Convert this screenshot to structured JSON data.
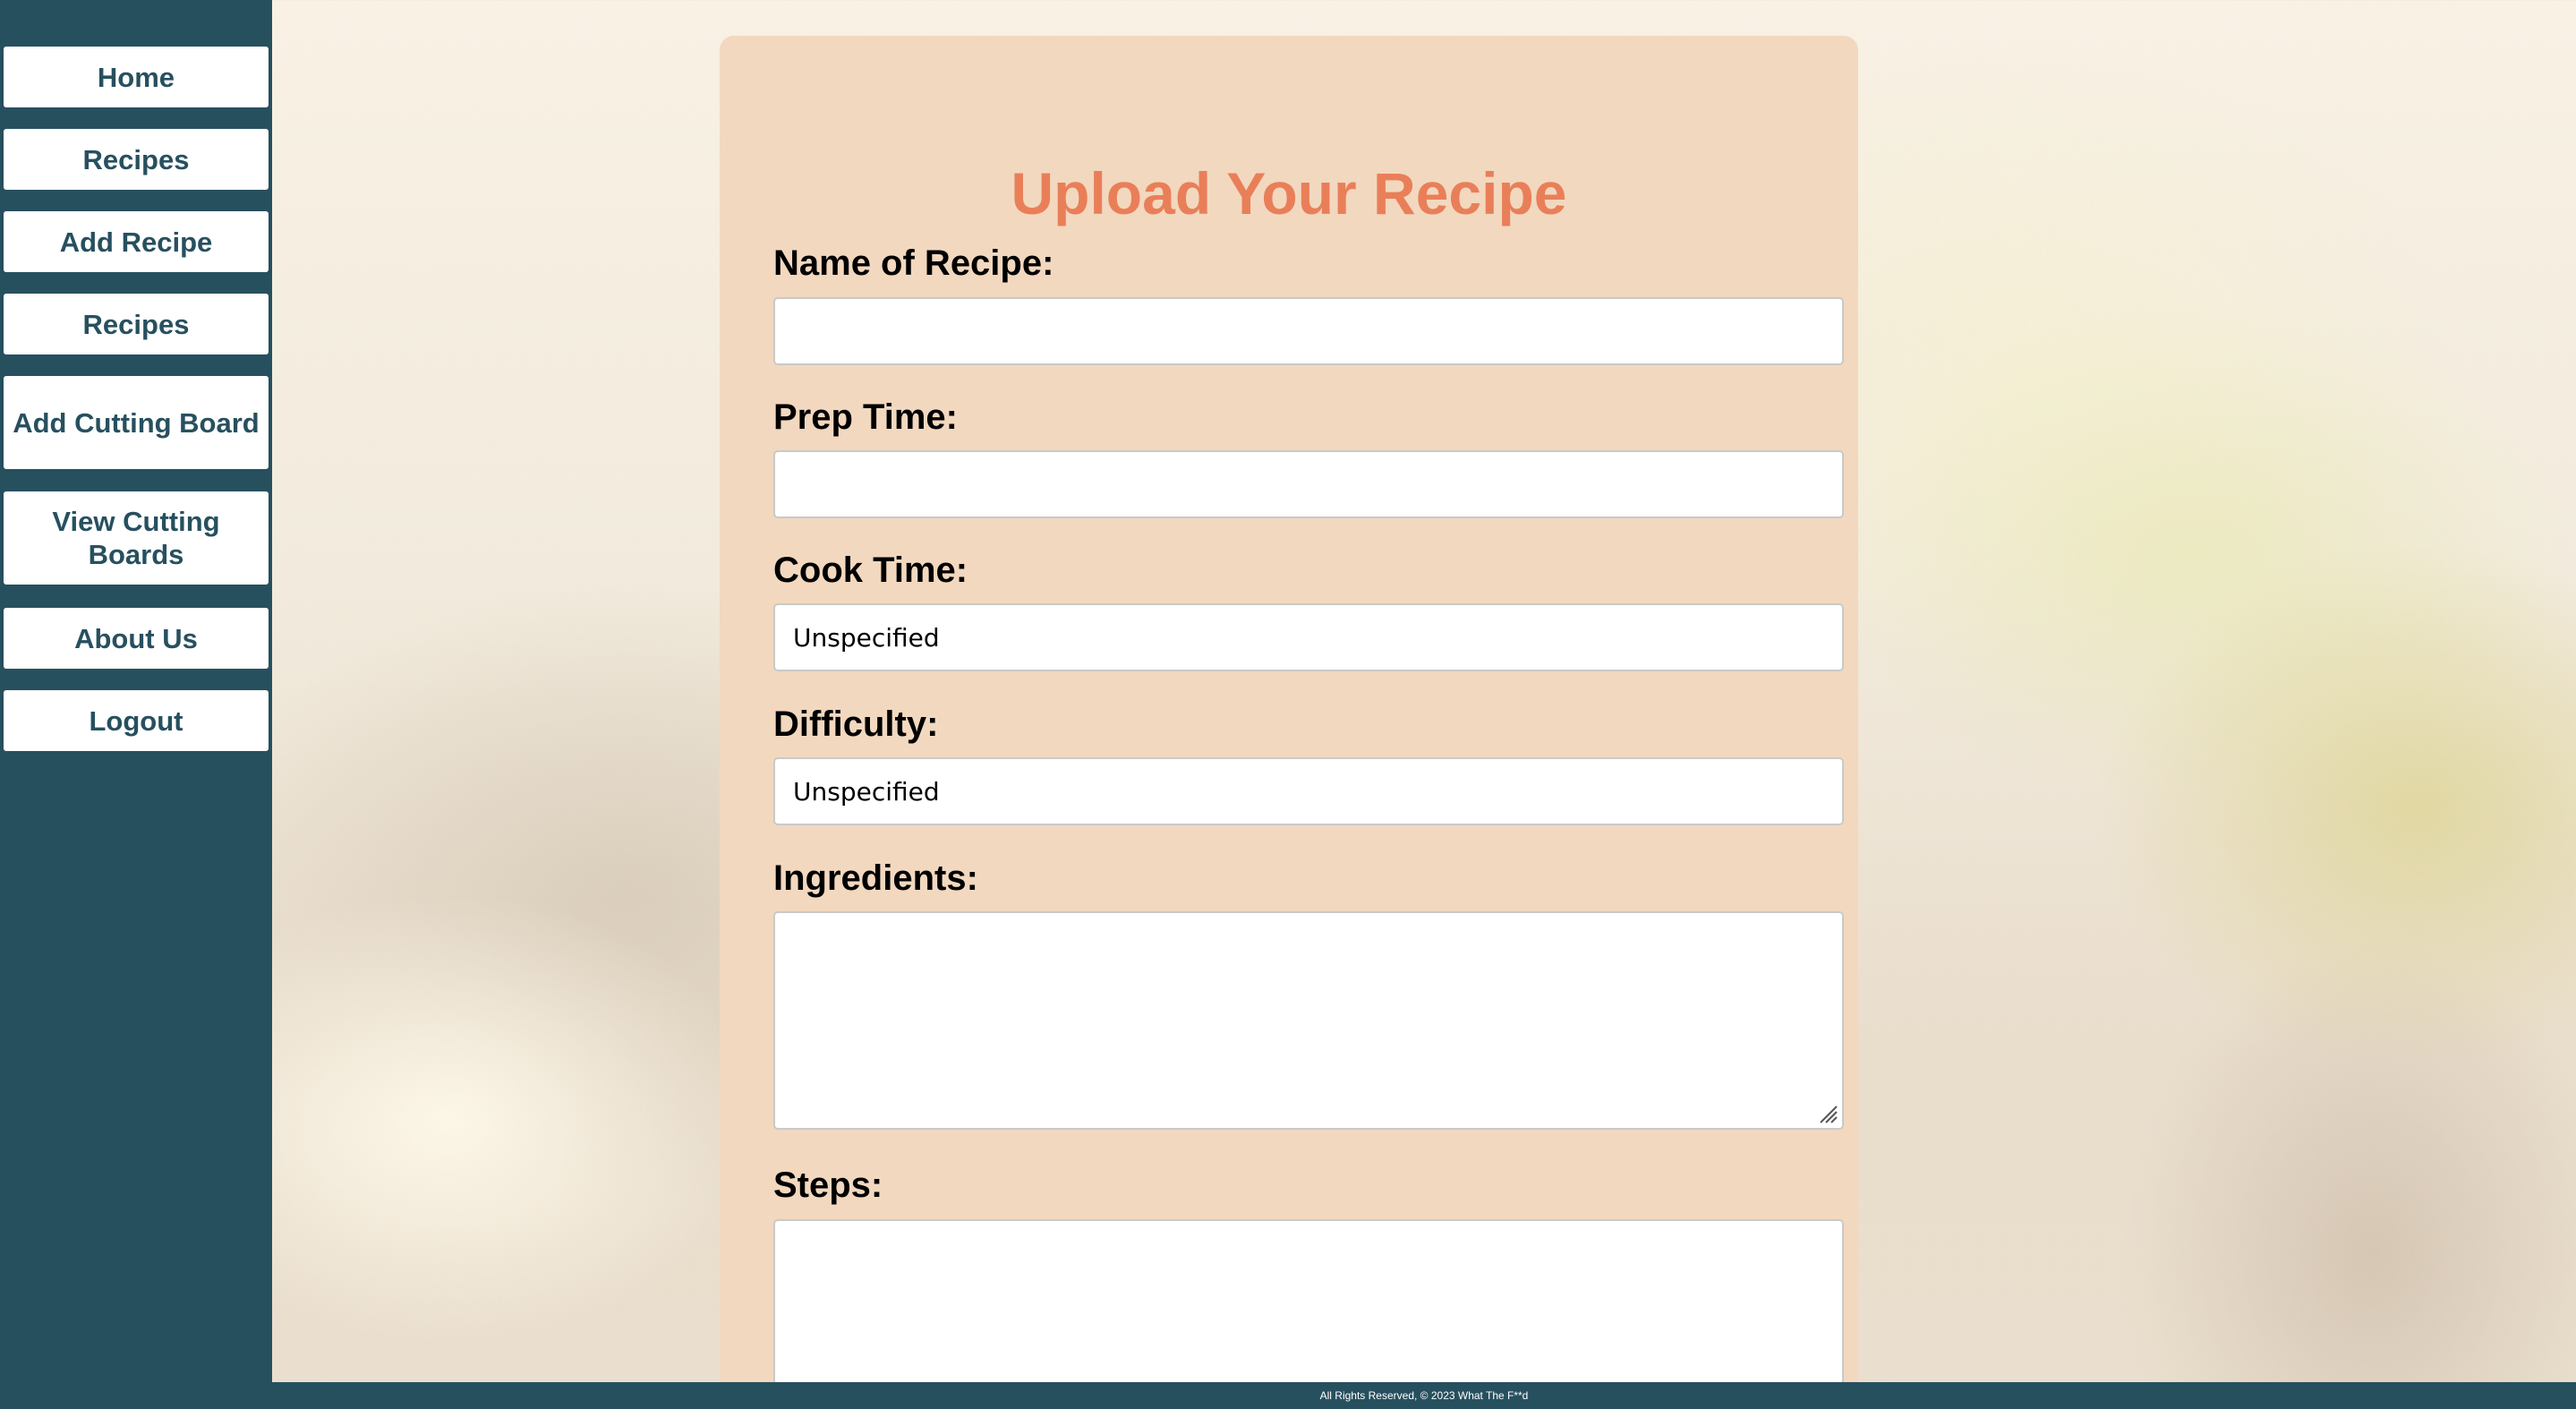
{
  "nav": {
    "items": [
      {
        "label": "Home"
      },
      {
        "label": "Recipes"
      },
      {
        "label": "Add Recipe"
      },
      {
        "label": "Recipes"
      },
      {
        "label": "Add Cutting Board"
      },
      {
        "label": "View Cutting Boards"
      },
      {
        "label": "About Us"
      },
      {
        "label": "Logout"
      }
    ]
  },
  "form": {
    "title": "Upload Your Recipe",
    "name_label": "Name of Recipe:",
    "name_value": "",
    "prep_label": "Prep Time:",
    "prep_value": "",
    "cook_label": "Cook Time:",
    "cook_value": "Unspecified",
    "difficulty_label": "Difficulty:",
    "difficulty_value": "Unspecified",
    "ingredients_label": "Ingredients:",
    "steps_label": "Steps:"
  },
  "footer": {
    "text": "All Rights Reserved, © 2023 What The F**d"
  },
  "colors": {
    "sidebar": "#27505f",
    "card": "#f2d8bf",
    "title": "#e97f59"
  }
}
